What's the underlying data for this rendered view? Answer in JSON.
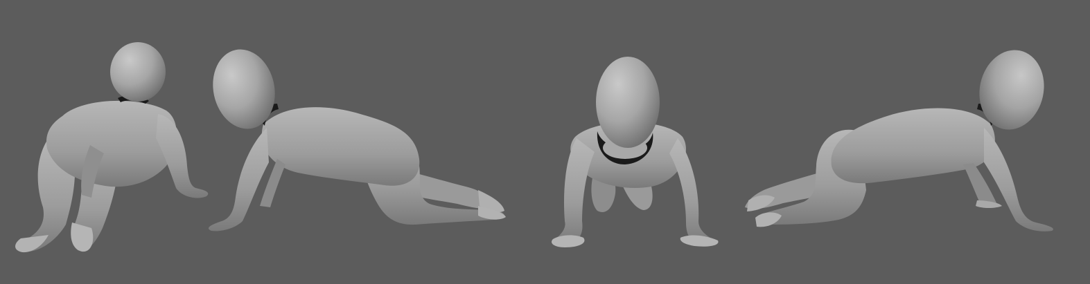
{
  "viewport": {
    "background": "#5c5c5c",
    "model_color": "#a4a4a4",
    "collar_color": "#1a1a1a"
  },
  "views": [
    {
      "view": "back-three-quarter"
    },
    {
      "view": "left-side"
    },
    {
      "view": "front"
    },
    {
      "view": "right-side"
    }
  ]
}
